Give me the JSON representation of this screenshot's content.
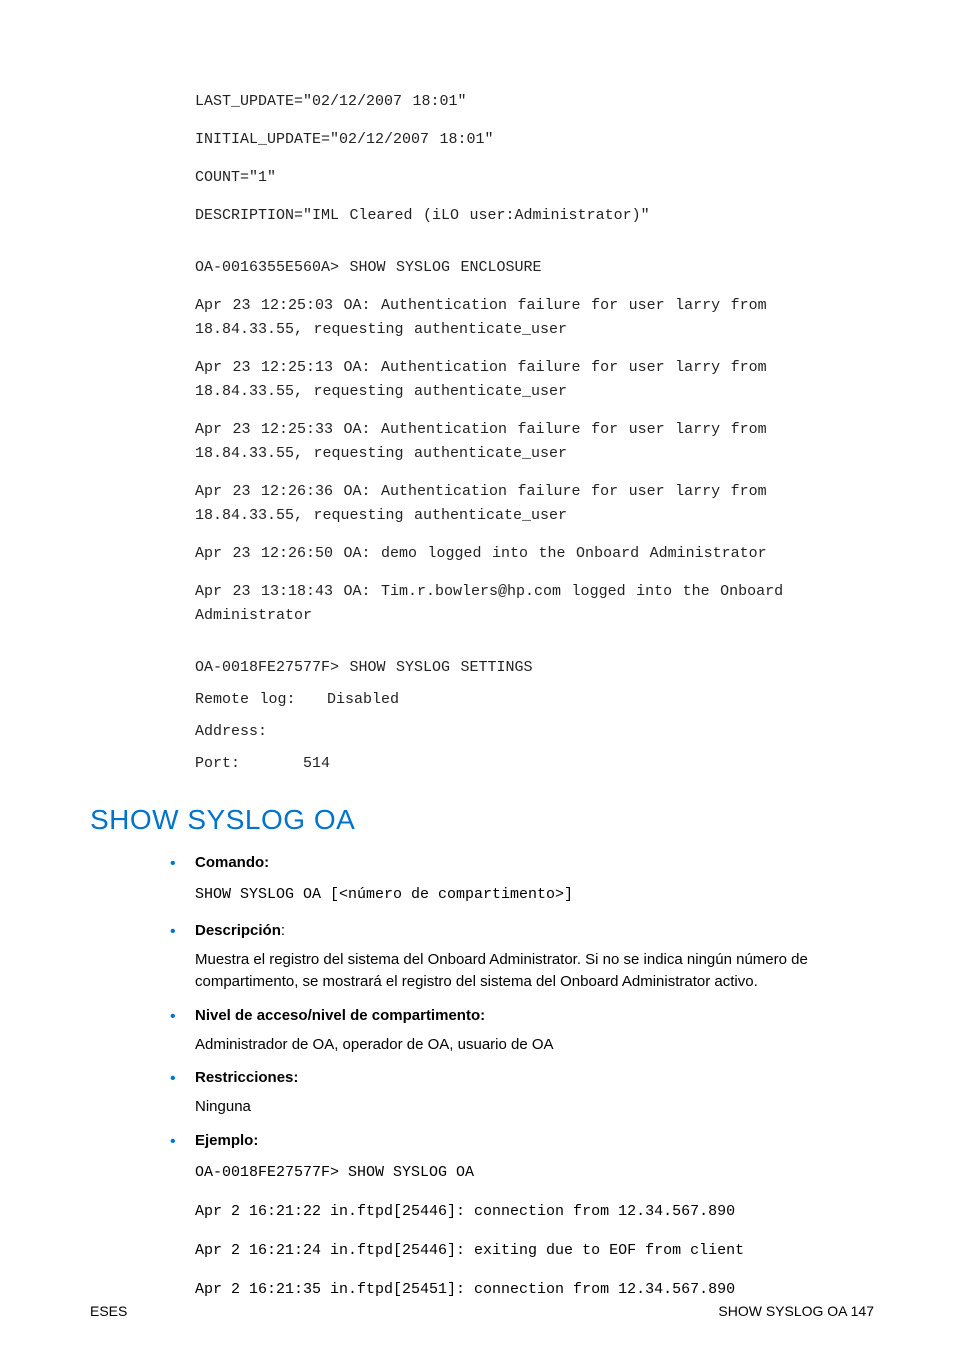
{
  "top_code": [
    "LAST_UPDATE=\"02/12/2007 18:01\"",
    "INITIAL_UPDATE=\"02/12/2007 18:01\"",
    "COUNT=\"1\"",
    "DESCRIPTION=\"IML Cleared (iLO user:Administrator)\""
  ],
  "enclosure_block": [
    "OA-0016355E560A> SHOW SYSLOG ENCLOSURE",
    "Apr 23 12:25:03 OA: Authentication failure for user larry from 18.84.33.55, requesting authenticate_user",
    "Apr 23 12:25:13 OA: Authentication failure for user larry from 18.84.33.55, requesting authenticate_user",
    "Apr 23 12:25:33 OA: Authentication failure for user larry from 18.84.33.55, requesting authenticate_user",
    "Apr 23 12:26:36 OA: Authentication failure for user larry from 18.84.33.55, requesting authenticate_user",
    "Apr 23 12:26:50 OA: demo logged into the Onboard Administrator",
    "Apr 23 13:18:43 OA: Tim.r.bowlers@hp.com logged into the Onboard Administrator"
  ],
  "settings_block": [
    "OA-0018FE27577F> SHOW SYSLOG SETTINGS",
    "Remote log:   Disabled",
    "Address:",
    "Port:      514"
  ],
  "section_title": "SHOW SYSLOG OA",
  "items": {
    "comando": {
      "label": "Comando:",
      "body": "SHOW SYSLOG OA [<número de compartimento>]"
    },
    "descripcion": {
      "label": "Descripción",
      "colon": ":",
      "body": "Muestra el registro del sistema del Onboard Administrator. Si no se indica ningún número de compartimento, se mostrará el registro del sistema del Onboard Administrator activo."
    },
    "nivel": {
      "label": "Nivel de acceso/nivel de compartimento:",
      "body": "Administrador de OA, operador de OA, usuario de OA"
    },
    "restricciones": {
      "label": "Restricciones:",
      "body": "Ninguna"
    },
    "ejemplo": {
      "label": "Ejemplo:",
      "lines": [
        "OA-0018FE27577F> SHOW SYSLOG OA",
        "Apr 2 16:21:22 in.ftpd[25446]: connection from 12.34.567.890",
        "Apr 2 16:21:24 in.ftpd[25446]: exiting due to EOF from client",
        "Apr 2 16:21:35 in.ftpd[25451]: connection from 12.34.567.890"
      ]
    }
  },
  "footer": {
    "left": "ESES",
    "right": "SHOW SYSLOG OA  147"
  }
}
